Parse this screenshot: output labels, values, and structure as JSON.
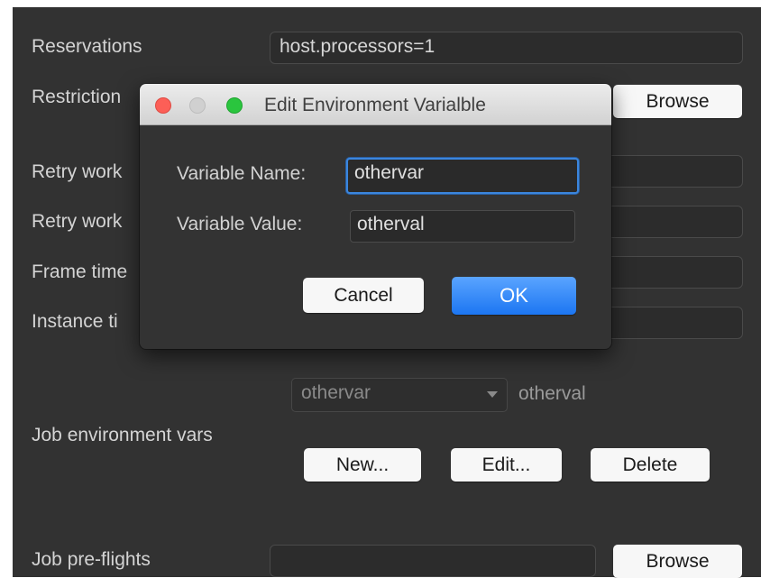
{
  "form": {
    "reservations_label": "Reservations",
    "reservations_value": "host.processors=1",
    "restriction_label": "Restriction",
    "retry_work_label_1": "Retry work",
    "retry_work_label_2": "Retry work",
    "frame_time_label": "Frame time",
    "instance_time_label": "Instance ti",
    "browse_label": "Browse",
    "env_vars_label": "Job environment vars",
    "env_selected_var": "othervar",
    "env_selected_val": "otherval",
    "new_label": "New...",
    "edit_label": "Edit...",
    "delete_label": "Delete",
    "preflights_label": "Job pre-flights",
    "preflights_browse_label": "Browse"
  },
  "dialog": {
    "title": "Edit Environment Varialble",
    "name_label": "Variable Name:",
    "name_value": "othervar",
    "value_label": "Variable Value:",
    "value_value": "otherval",
    "cancel_label": "Cancel",
    "ok_label": "OK"
  },
  "colors": {
    "background": "#323232",
    "accent_blue": "#2a84ff",
    "close": "#fc5f57",
    "minimize_disabled": "#d4d4d4",
    "zoom": "#2ac53e"
  },
  "icons": {
    "dropdown": "chevron-down-icon",
    "close": "close-traffic-light-icon",
    "minimize": "minimize-traffic-light-icon",
    "zoom": "zoom-traffic-light-icon"
  }
}
